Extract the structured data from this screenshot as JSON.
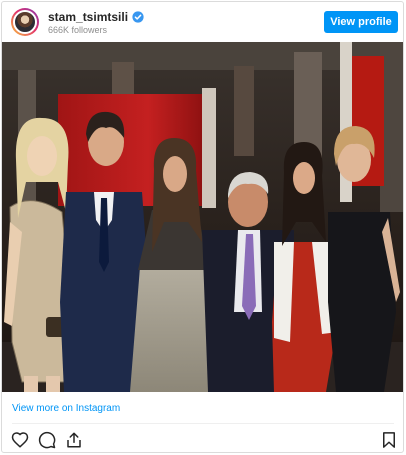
{
  "post": {
    "username": "stam_tsimtsili",
    "followers": "666K followers",
    "view_profile_label": "View profile",
    "view_more_label": "View more on Instagram",
    "verified_icon": "verified-badge-icon",
    "actions": [
      "heart-icon",
      "comment-icon",
      "share-icon",
      "bookmark-icon"
    ]
  },
  "colors": {
    "accent": "#0095f6",
    "text": "#262626",
    "muted": "#8e8e8e",
    "border": "#dbdbdb"
  }
}
